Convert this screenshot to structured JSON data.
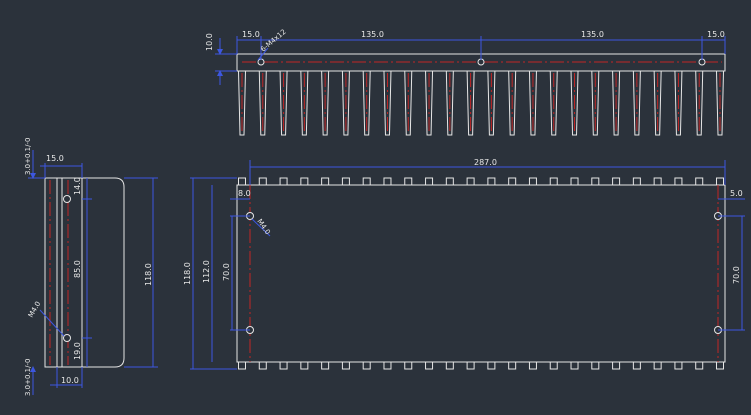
{
  "colors": {
    "background": "#2b323b",
    "outline": "#e6e6e6",
    "dimension": "#3d57e0",
    "centerline": "#c02626",
    "text": "#e8e8e8"
  },
  "top_view": {
    "dims": {
      "height": "10.0",
      "left_offset": "15.0",
      "span_1": "135.0",
      "span_2": "135.0",
      "right_offset": "15.0"
    },
    "hole_label": "6-M4x12",
    "fin_count": 24
  },
  "side_view": {
    "dims": {
      "top_tol": "3.0+0.1/-0",
      "width": "15.0",
      "upper": "14.0",
      "middle": "85.0",
      "lower": "19.0",
      "bottom": "10.0",
      "bottom_tol": "3.0+0.1/-0",
      "overall": "118.0"
    },
    "hole_label": "M4.0"
  },
  "bottom_view": {
    "dims": {
      "length": "287.0",
      "left_inset": "8.0",
      "right_inset": "5.0",
      "overall_height": "118.0",
      "inner_height": "112.0",
      "hole_spacing_left": "70.0",
      "hole_spacing_right": "70.0"
    },
    "hole_label": "M4.0"
  }
}
